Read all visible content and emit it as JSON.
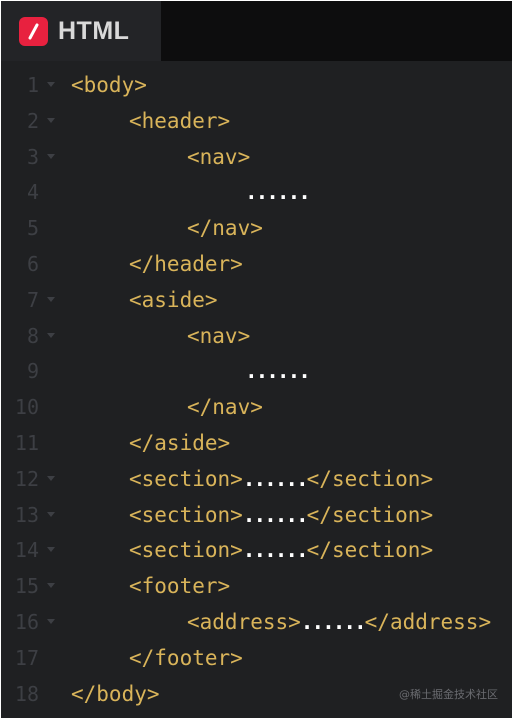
{
  "tab": {
    "label": "HTML",
    "icon": "html-file-icon",
    "accent": "#e8213f"
  },
  "editor": {
    "text_color": "#d9b45a",
    "lines": [
      {
        "num": "1",
        "fold": true,
        "code": "<body>",
        "dots": "",
        "tail": ""
      },
      {
        "num": "2",
        "fold": true,
        "code": "<header>",
        "dots": "",
        "tail": ""
      },
      {
        "num": "3",
        "fold": true,
        "code": "<nav>",
        "dots": "",
        "tail": ""
      },
      {
        "num": "4",
        "fold": false,
        "code": "",
        "dots": "......",
        "tail": ""
      },
      {
        "num": "5",
        "fold": false,
        "code": "</nav>",
        "dots": "",
        "tail": ""
      },
      {
        "num": "6",
        "fold": false,
        "code": "</header>",
        "dots": "",
        "tail": ""
      },
      {
        "num": "7",
        "fold": true,
        "code": "<aside>",
        "dots": "",
        "tail": ""
      },
      {
        "num": "8",
        "fold": true,
        "code": "<nav>",
        "dots": "",
        "tail": ""
      },
      {
        "num": "9",
        "fold": false,
        "code": "",
        "dots": "......",
        "tail": ""
      },
      {
        "num": "10",
        "fold": false,
        "code": "</nav>",
        "dots": "",
        "tail": ""
      },
      {
        "num": "11",
        "fold": false,
        "code": "</aside>",
        "dots": "",
        "tail": ""
      },
      {
        "num": "12",
        "fold": true,
        "code": "<section>",
        "dots": "......",
        "tail": "</section>"
      },
      {
        "num": "13",
        "fold": true,
        "code": "<section>",
        "dots": "......",
        "tail": "</section>"
      },
      {
        "num": "14",
        "fold": true,
        "code": "<section>",
        "dots": "......",
        "tail": "</section>"
      },
      {
        "num": "15",
        "fold": true,
        "code": "<footer>",
        "dots": "",
        "tail": ""
      },
      {
        "num": "16",
        "fold": true,
        "code": "<address>",
        "dots": "......",
        "tail": "</address>"
      },
      {
        "num": "17",
        "fold": false,
        "code": "</footer>",
        "dots": "",
        "tail": ""
      },
      {
        "num": "18",
        "fold": false,
        "code": "</body>",
        "dots": "",
        "tail": ""
      }
    ]
  },
  "watermark": "@稀土掘金技术社区"
}
